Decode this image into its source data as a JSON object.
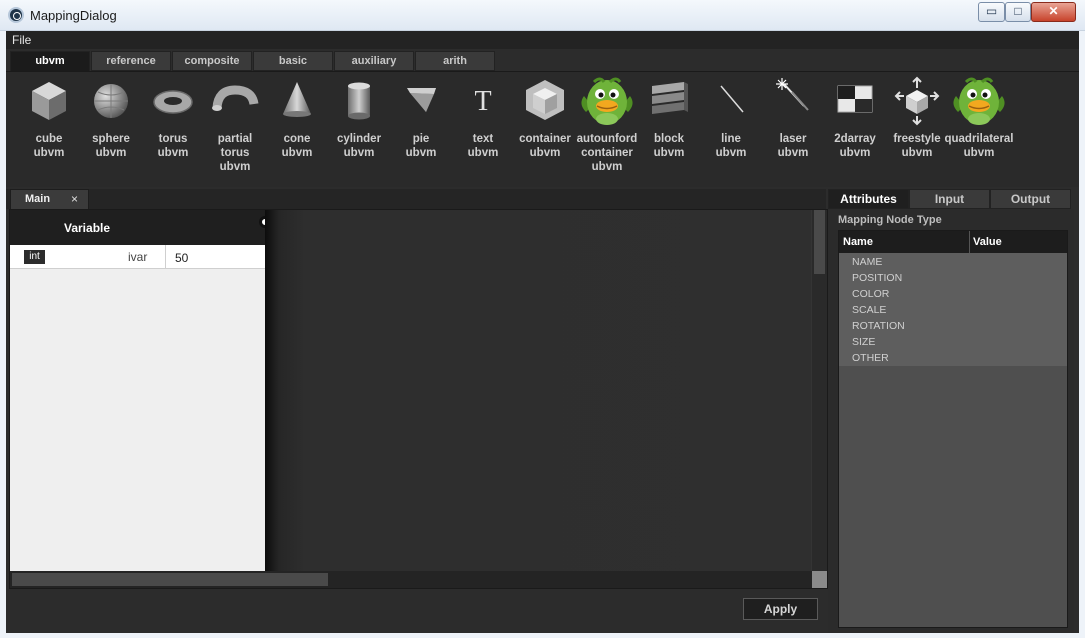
{
  "window": {
    "title": "MappingDialog",
    "min": "▭",
    "max": "□",
    "close": "✕"
  },
  "menu": {
    "file": "File"
  },
  "palette_tabs": [
    {
      "label": "ubvm",
      "active": true
    },
    {
      "label": "reference",
      "active": false
    },
    {
      "label": "composite",
      "active": false
    },
    {
      "label": "basic",
      "active": false
    },
    {
      "label": "auxiliary",
      "active": false
    },
    {
      "label": "arith",
      "active": false
    }
  ],
  "palette_items": [
    {
      "lines": [
        "cube",
        "ubvm"
      ],
      "icon": "cube-icon"
    },
    {
      "lines": [
        "sphere",
        "ubvm"
      ],
      "icon": "sphere-icon"
    },
    {
      "lines": [
        "torus",
        "ubvm"
      ],
      "icon": "torus-icon"
    },
    {
      "lines": [
        "partial",
        "torus",
        "ubvm"
      ],
      "icon": "partial-torus-icon"
    },
    {
      "lines": [
        "cone",
        "ubvm"
      ],
      "icon": "cone-icon"
    },
    {
      "lines": [
        "cylinder",
        "ubvm"
      ],
      "icon": "cylinder-icon"
    },
    {
      "lines": [
        "pie",
        "ubvm"
      ],
      "icon": "pie-icon"
    },
    {
      "lines": [
        "text",
        "ubvm"
      ],
      "icon": "text-icon",
      "glyph": "T"
    },
    {
      "lines": [
        "container",
        "ubvm"
      ],
      "icon": "container-icon"
    },
    {
      "lines": [
        "autounford",
        "container",
        "ubvm"
      ],
      "icon": "duck-icon"
    },
    {
      "lines": [
        "block",
        "ubvm"
      ],
      "icon": "block-icon"
    },
    {
      "lines": [
        "line",
        "ubvm"
      ],
      "icon": "line-icon"
    },
    {
      "lines": [
        "laser",
        "ubvm"
      ],
      "icon": "laser-icon"
    },
    {
      "lines": [
        "2darray",
        "ubvm"
      ],
      "icon": "2darray-icon"
    },
    {
      "lines": [
        "freestyle",
        "ubvm"
      ],
      "icon": "freestyle-icon"
    },
    {
      "lines": [
        "quadrilateral",
        "ubvm"
      ],
      "icon": "duck-icon"
    }
  ],
  "main_tab": {
    "label": "Main",
    "close": "×"
  },
  "variables": {
    "header": "Variable",
    "rows": [
      {
        "type": "int",
        "name": "ivar",
        "value": "50"
      }
    ]
  },
  "apply_label": "Apply",
  "attr_tabs": [
    {
      "label": "Attributes",
      "active": true
    },
    {
      "label": "Input",
      "active": false
    },
    {
      "label": "Output",
      "active": false
    }
  ],
  "mapping_node_type": "Mapping Node Type",
  "attr_table": {
    "columns": [
      "Name",
      "Value"
    ],
    "rows": [
      "NAME",
      "POSITION",
      "COLOR",
      "SCALE",
      "ROTATION",
      "SIZE",
      "OTHER"
    ]
  },
  "colors": {
    "background": "#2c2c2c",
    "accent": "#1f1f1f",
    "duck_green": "#6fb33a"
  }
}
